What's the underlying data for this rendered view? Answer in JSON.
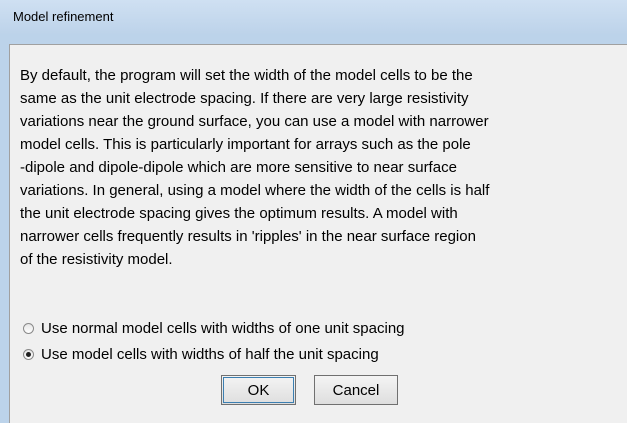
{
  "window": {
    "title": "Model refinement"
  },
  "description": {
    "lines": [
      "By default, the program will set the width of the model cells to be the",
      "same as the unit electrode spacing. If there are very large resistivity",
      "variations near the ground surface, you can use a model with narrower",
      "model cells. This is particularly important for arrays such as the pole",
      "-dipole and dipole-dipole which are more sensitive to near surface",
      "variations. In general, using a model where the width of the cells is half",
      "the unit electrode spacing gives the optimum results. A model with",
      "narrower cells frequently results in 'ripples' in the near surface region",
      "of the resistivity model."
    ]
  },
  "options": [
    {
      "label": "Use normal model cells with widths of one unit spacing",
      "checked": false
    },
    {
      "label": "Use model cells with widths of half the unit spacing",
      "checked": true
    }
  ],
  "buttons": {
    "ok_label": "OK",
    "cancel_label": "Cancel"
  }
}
